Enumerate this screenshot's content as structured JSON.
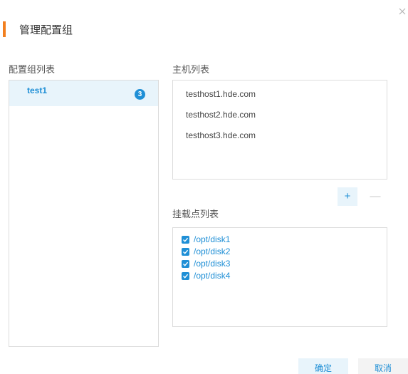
{
  "dialog": {
    "title": "管理配置组"
  },
  "groups": {
    "label": "配置组列表",
    "items": [
      {
        "name": "test1",
        "count": "3"
      }
    ]
  },
  "hosts": {
    "label": "主机列表",
    "items": [
      "testhost1.hde.com",
      "testhost2.hde.com",
      "testhost3.hde.com"
    ],
    "add_label": "+",
    "remove_label": "—"
  },
  "mounts": {
    "label": "挂载点列表",
    "items": [
      "/opt/disk1",
      "/opt/disk2",
      "/opt/disk3",
      "/opt/disk4"
    ]
  },
  "footer": {
    "confirm_label": "确定",
    "cancel_label": "取消"
  },
  "colors": {
    "accent": "#1f8fd6",
    "title_bar": "#f27f1f",
    "selected_bg": "#e8f4fb"
  },
  "icons": {
    "close": "close-icon",
    "checkbox": "checkbox-checked-icon"
  }
}
